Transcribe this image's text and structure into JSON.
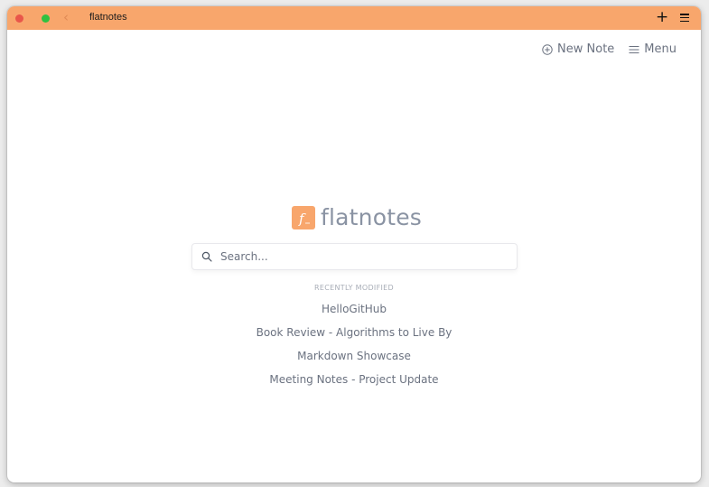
{
  "window": {
    "title": "flatnotes"
  },
  "colors": {
    "accent": "#f8a66c",
    "close": "#e9564a",
    "maximize": "#2fc140",
    "muted_text": "#6b7280",
    "logo_text": "#8a93a3"
  },
  "titlebar": {
    "back_icon": "chevron-left-icon",
    "new_tab_icon": "plus-icon",
    "menu_icon": "hamburger-icon",
    "back_glyph": "‹",
    "plus_glyph": "+"
  },
  "nav": {
    "new_note_label": "New Note",
    "new_note_icon": "plus-circle-icon",
    "menu_label": "Menu",
    "menu_icon": "hamburger-icon"
  },
  "logo": {
    "text": "flatnotes",
    "glyph": "f"
  },
  "search": {
    "placeholder": "Search...",
    "value": ""
  },
  "recent": {
    "heading": "RECENTLY MODIFIED",
    "items": [
      "HelloGitHub",
      "Book Review - Algorithms to Live By",
      "Markdown Showcase",
      "Meeting Notes - Project Update"
    ]
  }
}
